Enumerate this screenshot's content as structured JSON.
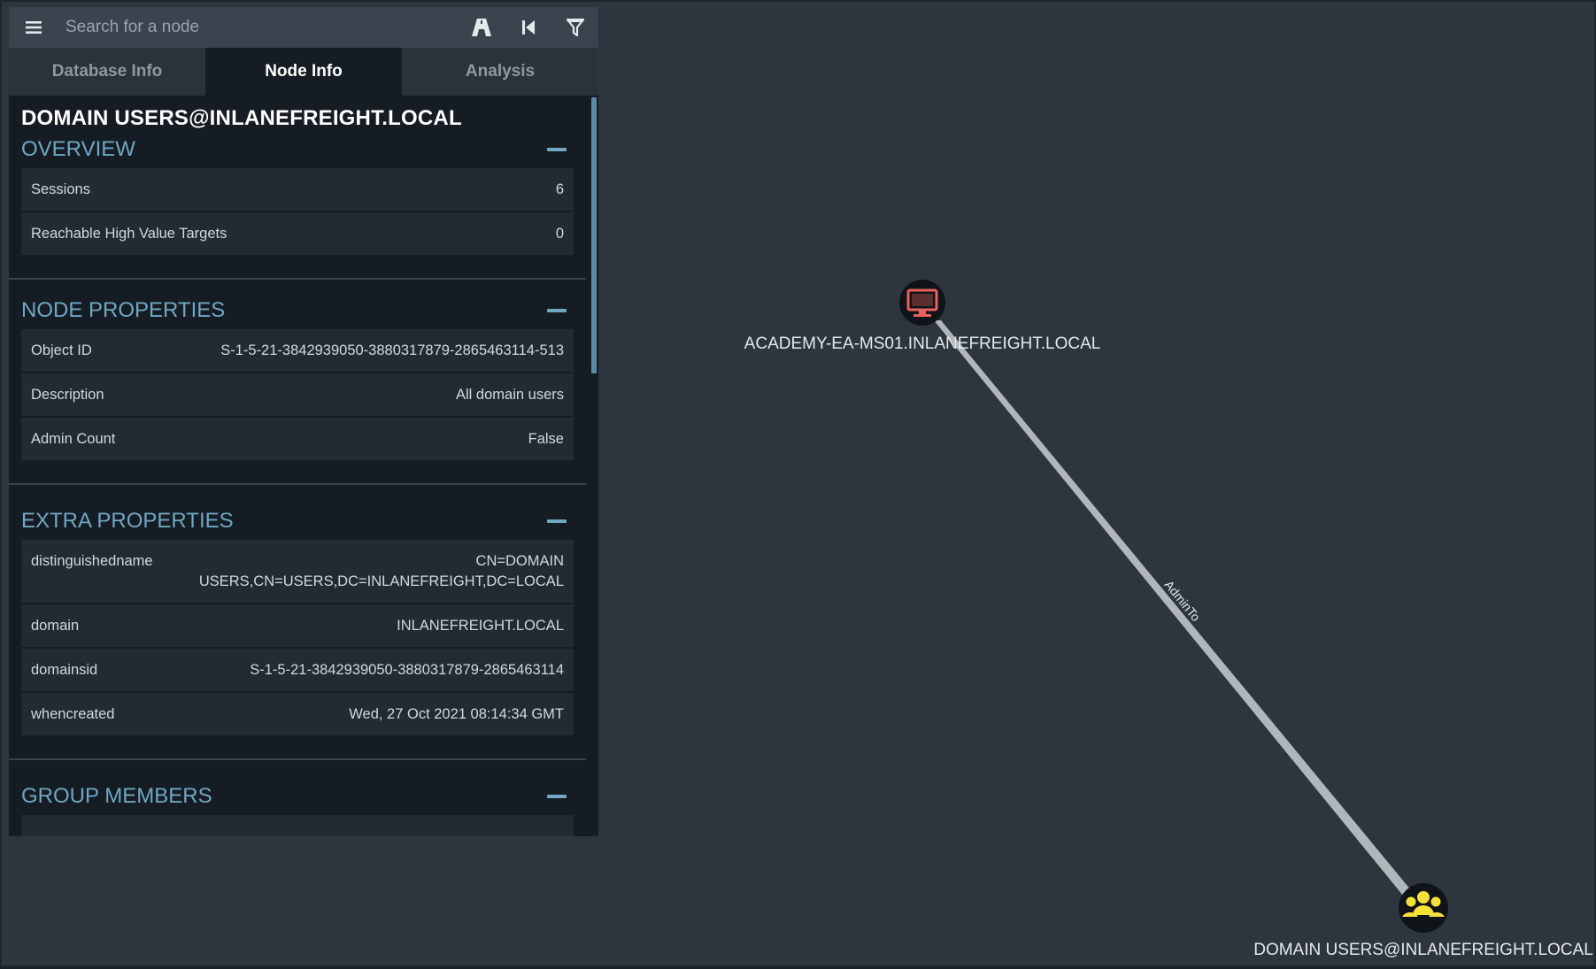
{
  "search": {
    "placeholder": "Search for a node"
  },
  "icons": {
    "menu": "hamburger-menu-icon",
    "pathfinding": "pathfinding-road-icon",
    "back": "skip-back-icon",
    "filter": "filter-funnel-icon",
    "computer": "computer-monitor-icon",
    "group": "group-users-icon"
  },
  "tabs": [
    {
      "label": "Database Info"
    },
    {
      "label": "Node Info",
      "active": true
    },
    {
      "label": "Analysis"
    }
  ],
  "node": {
    "title": "DOMAIN USERS@INLANEFREIGHT.LOCAL"
  },
  "sections": {
    "overview": {
      "title": "OVERVIEW",
      "rows": [
        {
          "key": "Sessions",
          "value": "6"
        },
        {
          "key": "Reachable High Value Targets",
          "value": "0"
        }
      ]
    },
    "node_properties": {
      "title": "NODE PROPERTIES",
      "rows": [
        {
          "key": "Object ID",
          "value": "S-1-5-21-3842939050-3880317879-2865463114-513"
        },
        {
          "key": "Description",
          "value": "All domain users"
        },
        {
          "key": "Admin Count",
          "value": "False"
        }
      ]
    },
    "extra_properties": {
      "title": "EXTRA PROPERTIES",
      "rows": [
        {
          "key": "distinguishedname",
          "value": "CN=DOMAIN USERS,CN=USERS,DC=INLANEFREIGHT,DC=LOCAL"
        },
        {
          "key": "domain",
          "value": "INLANEFREIGHT.LOCAL"
        },
        {
          "key": "domainsid",
          "value": "S-1-5-21-3842939050-3880317879-2865463114"
        },
        {
          "key": "whencreated",
          "value": "Wed, 27 Oct 2021 08:14:34 GMT"
        }
      ]
    },
    "group_members": {
      "title": "GROUP MEMBERS"
    }
  },
  "graph": {
    "nodes": [
      {
        "id": "computer",
        "label": "ACADEMY-EA-MS01.INLANEFREIGHT.LOCAL",
        "type": "Computer",
        "color": "#e8605a"
      },
      {
        "id": "group",
        "label": "DOMAIN USERS@INLANEFREIGHT.LOCAL",
        "type": "Group",
        "color": "#f5e03a"
      }
    ],
    "edges": [
      {
        "from": "group",
        "to": "computer",
        "label": "AdminTo"
      }
    ]
  },
  "colors": {
    "canvas_bg": "#2d353e",
    "panel_bg": "#161c23",
    "accent": "#6fa7c4",
    "edge": "#c9cdd1"
  }
}
